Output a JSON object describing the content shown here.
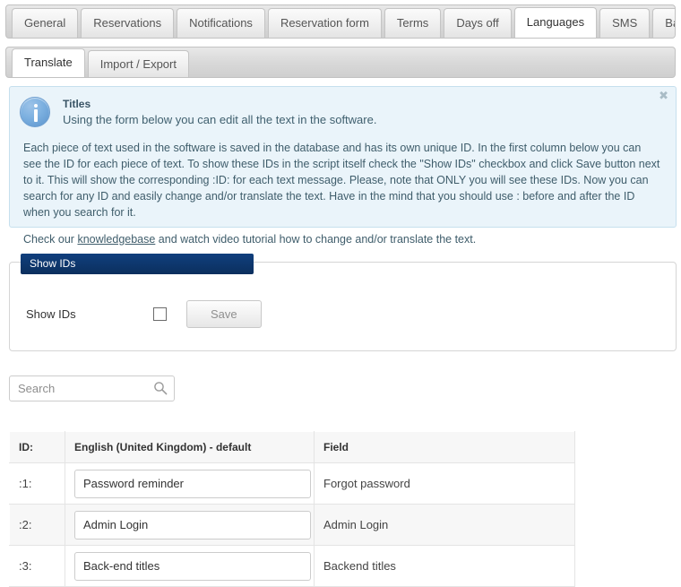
{
  "main_tabs": [
    {
      "label": "General",
      "active": false
    },
    {
      "label": "Reservations",
      "active": false
    },
    {
      "label": "Notifications",
      "active": false
    },
    {
      "label": "Reservation form",
      "active": false
    },
    {
      "label": "Terms",
      "active": false
    },
    {
      "label": "Days off",
      "active": false
    },
    {
      "label": "Languages",
      "active": true
    },
    {
      "label": "SMS",
      "active": false
    },
    {
      "label": "Backup",
      "active": false
    }
  ],
  "sub_tabs": [
    {
      "label": "Translate",
      "active": true
    },
    {
      "label": "Import / Export",
      "active": false
    }
  ],
  "info": {
    "icon": "info-circle-icon",
    "close_label": "✖",
    "title": "Titles",
    "subtitle": "Using the form below you can edit all the text in the software.",
    "paragraph": "Each piece of text used in the software is saved in the database and has its own unique ID. In the first column below you can see the ID for each piece of text. To show these IDs in the script itself check the \"Show IDs\" checkbox and click Save button next to it. This will show the corresponding :ID: for each text message. Please, note that ONLY you will see these IDs. Now you can search for any ID and easily change and/or translate the text. Have in the mind that you should use : before and after the ID when you search for it.",
    "footer_prefix": "Check our ",
    "footer_link": "knowledgebase",
    "footer_suffix": " and watch video tutorial how to change and/or translate the text."
  },
  "fieldset": {
    "legend": "Show IDs",
    "row_label": "Show IDs",
    "checkbox_checked": false,
    "save_label": "Save"
  },
  "search": {
    "placeholder": "Search",
    "value": "",
    "icon": "search-icon"
  },
  "table": {
    "headers": [
      "ID:",
      "English (United Kingdom) - default",
      "Field"
    ],
    "rows": [
      {
        "id": ":1:",
        "translation": "Password reminder",
        "field": "Forgot password"
      },
      {
        "id": ":2:",
        "translation": "Admin Login",
        "field": "Admin Login"
      },
      {
        "id": ":3:",
        "translation": "Back-end titles",
        "field": "Backend titles"
      }
    ]
  },
  "colors": {
    "legend_bg": "#0b2f5e",
    "info_bg": "#eaf4fa",
    "info_border": "#c6e0ee",
    "table_stripe": "#f7f7f7"
  }
}
